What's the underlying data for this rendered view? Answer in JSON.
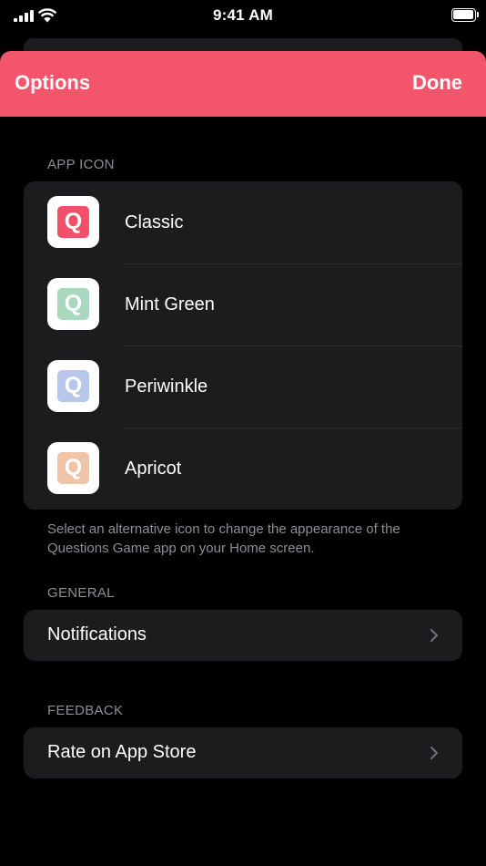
{
  "status_bar": {
    "time": "9:41 AM"
  },
  "nav": {
    "title": "Options",
    "done_label": "Done"
  },
  "app_icon_section": {
    "header": "APP ICON",
    "items": [
      {
        "label": "Classic",
        "letter": "Q",
        "color": "#f05068"
      },
      {
        "label": "Mint Green",
        "letter": "Q",
        "color": "#a8d8be"
      },
      {
        "label": "Periwinkle",
        "letter": "Q",
        "color": "#b8c6ea"
      },
      {
        "label": "Apricot",
        "letter": "Q",
        "color": "#f0c4a6"
      }
    ],
    "footer": "Select an alternative icon to change the appearance of the Questions Game app on your Home screen."
  },
  "general_section": {
    "header": "GENERAL",
    "notifications_label": "Notifications",
    "icon": "chevron-right-icon"
  },
  "feedback_section": {
    "header": "FEEDBACK",
    "rate_label": "Rate on App Store",
    "icon": "chevron-right-icon"
  },
  "colors": {
    "accent": "#f3566c",
    "background": "#000000",
    "cell": "#1c1c1e",
    "secondary_text": "#8e8e93"
  }
}
